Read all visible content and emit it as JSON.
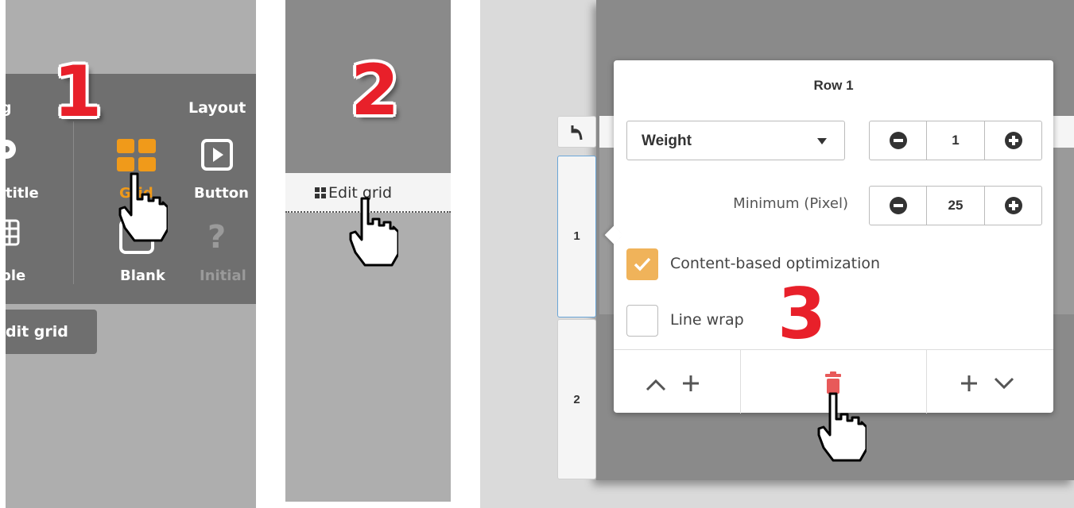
{
  "panel1": {
    "step": "1",
    "partial_left_label": "g",
    "layout_label": "Layout",
    "items": {
      "title": "title",
      "grid": "Grid",
      "button": "Button",
      "table": "ble",
      "blank": "Blank",
      "initial": "Initial"
    },
    "edit_grid": "dit grid",
    "colors": {
      "grid_icon": "#f09a1a",
      "initial_disabled": "#9a9a9a"
    }
  },
  "panel2": {
    "step": "2",
    "edit_grid_label": "Edit grid"
  },
  "panel3": {
    "back_icon": "undo-arrow-icon",
    "row_tabs": [
      "1",
      "2"
    ],
    "popup": {
      "title": "Row 1",
      "size_mode": "Weight",
      "weight_value": "1",
      "minimum_label": "Minimum (Pixel)",
      "minimum_value": "25",
      "content_opt_label": "Content-based optimization",
      "content_opt_checked": true,
      "line_wrap_label": "Line wrap",
      "line_wrap_checked": false,
      "footer": {
        "move_up_icons": [
          "chevron-up-icon",
          "plus-icon"
        ],
        "delete_icon": "trash-icon",
        "move_down_icons": [
          "plus-icon",
          "chevron-down-icon"
        ]
      }
    },
    "step": "3",
    "colors": {
      "checkbox_on": "#f0b35a",
      "delete": "#e85a5a",
      "step_red": "#e8202a"
    }
  }
}
